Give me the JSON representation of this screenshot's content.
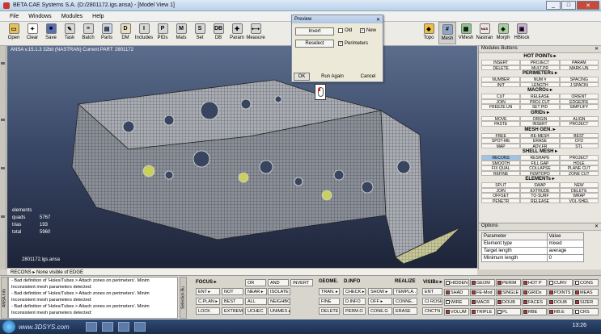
{
  "window": {
    "title": "BETA CAE Systems S.A. (D:/2801172.igs.ansa) - [Model View 1]",
    "minimize": "_",
    "maximize": "□",
    "close": "✕"
  },
  "menu": [
    "File",
    "Windows",
    "Modules",
    "Help"
  ],
  "toolbar": {
    "left": [
      {
        "label": "Open",
        "icon": "folder-icon",
        "glyph": "▭",
        "color": "#e7c35a"
      },
      {
        "label": "Clear",
        "icon": "clear-icon",
        "glyph": "✦",
        "color": "#ffffff"
      },
      {
        "label": "Save",
        "icon": "save-icon",
        "glyph": "■",
        "color": "#5b6fb3"
      },
      {
        "label": "Task",
        "icon": "task-icon",
        "glyph": "✎",
        "color": "#d7d7d7"
      },
      {
        "label": "Batch",
        "icon": "batch-icon",
        "glyph": "≡",
        "color": "#d7d7d7"
      },
      {
        "label": "Parts",
        "icon": "parts-icon",
        "glyph": "▤",
        "color": "#c9d6e8"
      },
      {
        "label": "DM",
        "icon": "dm-icon",
        "glyph": "D",
        "color": "#e8e0c0"
      },
      {
        "label": "Includes",
        "icon": "includes-icon",
        "glyph": "I",
        "color": "#d7d7d7"
      },
      {
        "label": "PIDs",
        "icon": "pids-icon",
        "glyph": "P",
        "color": "#d7d7d7"
      },
      {
        "label": "Mats",
        "icon": "mats-icon",
        "glyph": "M",
        "color": "#d7d7d7"
      },
      {
        "label": "Set",
        "icon": "set-icon",
        "glyph": "S",
        "color": "#d7d7d7"
      },
      {
        "label": "DB",
        "icon": "db-icon",
        "glyph": "DB",
        "color": "#d7d7d7"
      },
      {
        "label": "Param",
        "icon": "param-icon",
        "glyph": "✚",
        "color": "#d7d7d7"
      },
      {
        "label": "Measure",
        "icon": "measure-icon",
        "glyph": "⟷",
        "color": "#d7d7d7"
      }
    ],
    "right": [
      {
        "label": "Topo",
        "icon": "topo-icon",
        "glyph": "◆",
        "color": "#f0c040"
      },
      {
        "label": "Mesh",
        "icon": "mesh-icon",
        "glyph": "#",
        "color": "#8fa8c8",
        "active": true
      },
      {
        "label": "VMesh",
        "icon": "vmesh-icon",
        "glyph": "▦",
        "color": "#8fc88f"
      },
      {
        "label": "Nastran",
        "icon": "nastran-icon",
        "glyph": "NAS",
        "color": "#f5e0e0"
      },
      {
        "label": "Morph",
        "icon": "morph-icon",
        "glyph": "◈",
        "color": "#a8d0a0"
      },
      {
        "label": "HBlock",
        "icon": "hblock-icon",
        "glyph": "▣",
        "color": "#d0b0d8"
      }
    ]
  },
  "viewport": {
    "header": "ANSA v.15.1.3 32bit (NASTRAN)   Current PART: 2801172",
    "stats_title": "elements",
    "stats": [
      {
        "label": "quads",
        "value": "5767"
      },
      {
        "label": "trias",
        "value": "193"
      },
      {
        "label": "total",
        "value": "5960"
      }
    ],
    "filename": "2801172.igs.ansa"
  },
  "preview": {
    "title": "Preview",
    "close": "✕",
    "invert": "Invert",
    "reselect": "Reselect",
    "old_label": "Old",
    "old_checked": "",
    "new_label": "New",
    "new_checked": "✓",
    "perimeters_label": "Perimeters",
    "perimeters_checked": "✓",
    "ok": "OK",
    "run_again": "Run Again",
    "cancel": "Cancel"
  },
  "modules_panel": {
    "title": "Modules Buttons",
    "close": "✕",
    "groups": [
      {
        "title": "HOT POINTs ▸",
        "cells": [
          "INSERT",
          "PROJECT",
          "PARAM",
          "DELETE",
          "MULT.PR",
          "MARK-UN"
        ]
      },
      {
        "title": "PERIMETERs ▸",
        "cells": [
          "NUMBER",
          "NUM #",
          "SPACING",
          "INIT",
          "LENGTH",
          "J.SPACIN"
        ]
      },
      {
        "title": "MACROs ▸",
        "cells": [
          "CUT",
          "RELEASE",
          "ORIENT",
          "JOIN",
          "PROJ.CUT",
          "EDGE2FE",
          "FREEZE.UN",
          "SET PID",
          "SIMPLIFY"
        ]
      },
      {
        "title": "GRIDs ▸",
        "cells": [
          "MOVE",
          "ORIGIN",
          "ALIGN",
          "PASTE",
          "INSERT",
          "PROJECT"
        ]
      },
      {
        "title": "MESH GEN. ▸",
        "cells": [
          "FREE",
          "RE-MESH",
          "BEST",
          "SPOT-ME",
          "ERASE",
          "CFD",
          "MAP",
          "ADV.FR",
          "STL"
        ]
      },
      {
        "title": "SHELL MESH ▸",
        "cells": [
          "RECONS",
          "RESHAPE",
          "PROJECT",
          "SMOOTH",
          "FILL GAP",
          "HOLE",
          "FIX QUAL",
          "COLLAPSE",
          "PLANE CUT",
          "REFINE",
          "FEMTOPO",
          "ZONE CUT"
        ],
        "highlight": [
          0
        ]
      },
      {
        "title": "ELEMENTs ▸",
        "cells": [
          "SPLIT",
          "SWAP",
          "NEW",
          "JOIN",
          "EXTRUDE",
          "DELETE",
          "OFFSET",
          "TO-SURF",
          "WRAP",
          "PENETR",
          "RELEASE",
          "VOL-SHEL"
        ]
      }
    ]
  },
  "options_panel": {
    "title": "Options",
    "close": "✕",
    "header": [
      "Parameter",
      "Value"
    ],
    "rows": [
      {
        "param": "Element type",
        "value": "mixed"
      },
      {
        "param": "Target length",
        "value": "average"
      },
      {
        "param": "Minimum length",
        "value": "0"
      }
    ]
  },
  "status_line": "RECONS ▸   None visible of EDGE",
  "log": [
    "- Bad definition of 'Holes/Tubes > Attach zones on perimeters'. Minim",
    "Inconsistent mesh parameters detected:",
    "- Bad definition of 'Holes/Tubes > Attach zones on perimeters'. Minim",
    "Inconsistent mesh parameters detected:",
    "- Bad definition of 'Holes/Tubes > Attach zones on perimeters'. Minim",
    "Inconsistent mesh parameters detected:"
  ],
  "vtabs": {
    "ansa_info": "ANSA Info",
    "selection": "Selection Bu"
  },
  "bottom": {
    "focus_title": "FOCUS ▸",
    "focus_buttons": [
      "OR",
      "AND",
      "INVERT",
      "ENT ▸",
      "NOT",
      "NEAR ▸",
      "ISOLATE",
      "C.PLAN ▸",
      "BEST",
      "ALL",
      "NEIGHBO",
      "LOCK",
      "EXTREM",
      "UCHEC",
      "UNIMES ▸"
    ],
    "geom_title": "GEOME.",
    "geom_buttons": [
      "TRAN. ▸",
      "FINE",
      "DELETE"
    ],
    "dinfo_title": "D.INFO",
    "dinfo_buttons": [
      "CHECK ▸",
      "D.INFO",
      "PERM.O"
    ],
    "realize_title": "REALIZE",
    "realize_buttons": [
      "SHOW ▸",
      "TEMPLA..",
      "OFF ▸",
      "CONNE..",
      "CONE.G",
      "ERASE"
    ],
    "vis_title": "VISIBs ▸",
    "vis_left": [
      "ENT",
      "CI ROSH",
      "CNCTN"
    ],
    "vis_chips": [
      {
        "label": "HIDDEN",
        "color": "#ffffff"
      },
      {
        "label": "GEOM",
        "color": "#c23030"
      },
      {
        "label": "PERIM",
        "color": "#c23030"
      },
      {
        "label": "HOT P",
        "color": "#c23030"
      },
      {
        "label": "CURV",
        "color": "#ffffff"
      },
      {
        "label": "CONS",
        "color": "#ffffff"
      },
      {
        "label": "SHAD",
        "color": "#c23030"
      },
      {
        "label": "FE-Mod",
        "color": "#c23030"
      },
      {
        "label": "SINGLE",
        "color": "#c23030"
      },
      {
        "label": "GRIDs",
        "color": "#c23030"
      },
      {
        "label": "POINTS",
        "color": "#c23030"
      },
      {
        "label": "MEAS",
        "color": "#c23030"
      },
      {
        "label": "WIRE",
        "color": "#ffffff"
      },
      {
        "label": "MACR",
        "color": "#c23030"
      },
      {
        "label": "DOUB",
        "color": "#c23030"
      },
      {
        "label": "FACES",
        "color": "#c23030"
      },
      {
        "label": "DOUB",
        "color": "#c23030"
      },
      {
        "label": "SIZER",
        "color": "#c23030"
      },
      {
        "label": "VOLUM",
        "color": "#c23030"
      },
      {
        "label": "TRIPLE",
        "color": "#c23030"
      },
      {
        "label": "PL",
        "color": "#ffffff"
      },
      {
        "label": "RBE",
        "color": "#c23030"
      },
      {
        "label": "RB.E",
        "color": "#c23030"
      },
      {
        "label": "CRS",
        "color": "#ffffff"
      }
    ]
  },
  "taskbar": {
    "watermark": "www.3DSYS.com",
    "clock": "13:26"
  }
}
